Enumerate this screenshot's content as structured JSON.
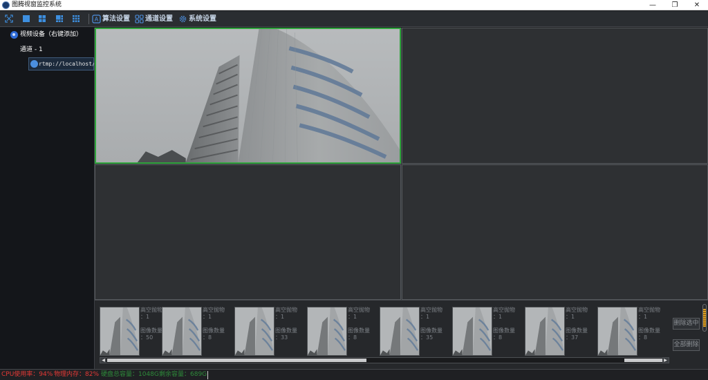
{
  "app": {
    "title": "图腾视窗监控系统",
    "window_controls": {
      "minimize": "—",
      "restore": "❐",
      "close": "✕"
    }
  },
  "toolbar": {
    "layout_icons": [
      "fullscreen-icon",
      "layout-1-icon",
      "layout-4-icon",
      "layout-6-icon",
      "layout-9-icon"
    ],
    "menu": [
      {
        "label": "算法设置",
        "icon": "algorithm-icon"
      },
      {
        "label": "通道设置",
        "icon": "channel-grid-icon"
      },
      {
        "label": "系统设置",
        "icon": "gear-icon"
      }
    ]
  },
  "sidebar": {
    "root": "视频设备（右键添加）",
    "channel": "通道 - 1",
    "url": "rtmp://localhost/live"
  },
  "thumbnails": [
    {
      "type_label": "高空抛物",
      "type_count": "：1",
      "image_label": "图像数量",
      "image_count": "：50"
    },
    {
      "type_label": "高空抛物",
      "type_count": "：1",
      "image_label": "图像数量",
      "image_count": "：8"
    },
    {
      "type_label": "高空抛物",
      "type_count": "：1",
      "image_label": "图像数量",
      "image_count": "：33"
    },
    {
      "type_label": "高空抛物",
      "type_count": "：1",
      "image_label": "图像数量",
      "image_count": "：8"
    },
    {
      "type_label": "高空抛物",
      "type_count": "：1",
      "image_label": "图像数量",
      "image_count": "：35"
    },
    {
      "type_label": "高空抛物",
      "type_count": "：1",
      "image_label": "图像数量",
      "image_count": "：8"
    },
    {
      "type_label": "高空抛物",
      "type_count": "：1",
      "image_label": "图像数量",
      "image_count": "：37"
    },
    {
      "type_label": "高空抛物",
      "type_count": "：1",
      "image_label": "图像数量",
      "image_count": "：8"
    }
  ],
  "actions": {
    "delete_selected": "删除选中",
    "delete_all": "全部删除"
  },
  "status": {
    "cpu": "CPU使用率：94%",
    "mem": "物理内存：82%",
    "disk_total": "硬盘总容量：1048G",
    "disk_free": "剩余容量：689G"
  },
  "colors": {
    "status_alert": "#e53935",
    "status_ok": "#2e8b3a",
    "active_pane": "#2fa53c",
    "toolbar_text": "#c6d4e6"
  }
}
